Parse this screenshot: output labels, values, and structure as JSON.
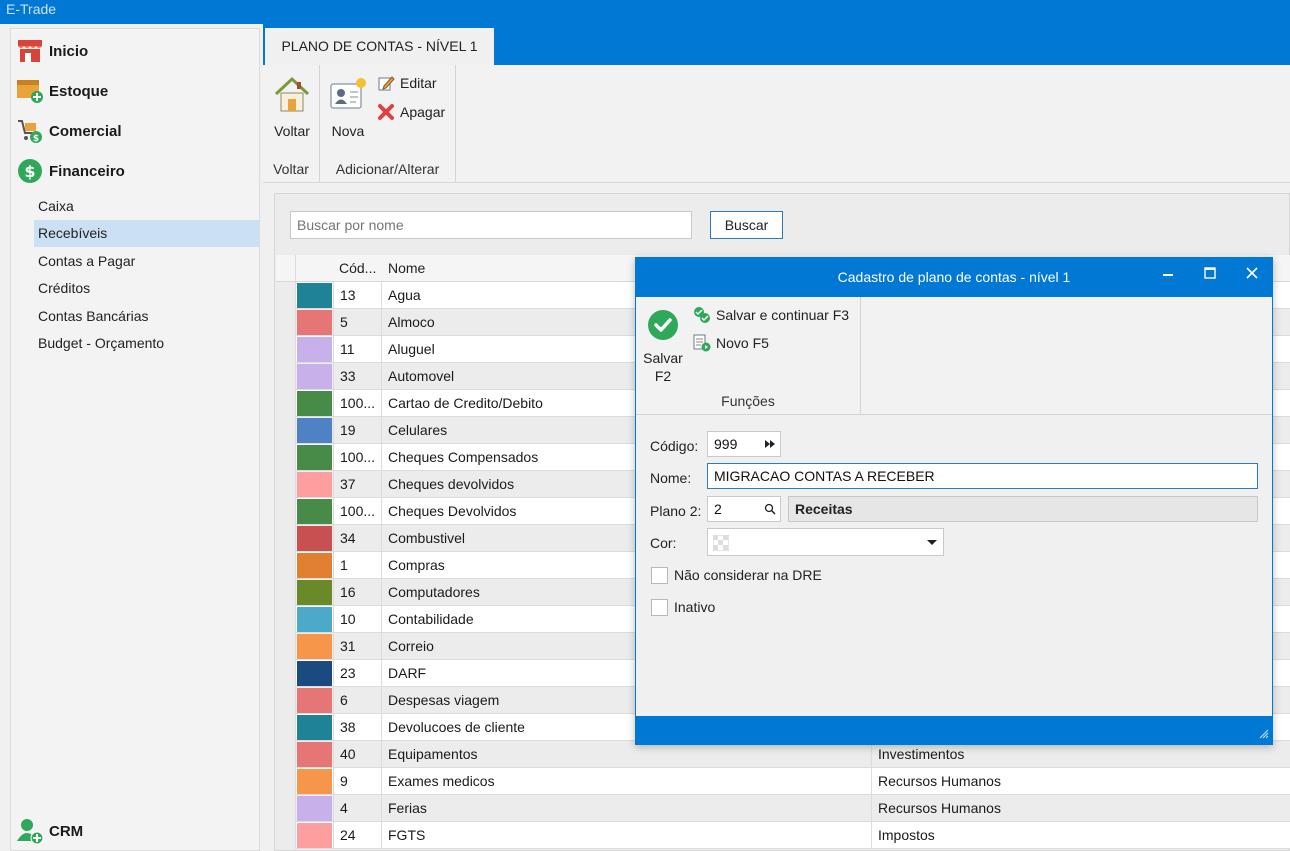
{
  "window": {
    "title": "E-Trade"
  },
  "sidebar": {
    "main": [
      {
        "label": "Inicio",
        "icon": "store-icon"
      },
      {
        "label": "Estoque",
        "icon": "box-add-icon"
      },
      {
        "label": "Comercial",
        "icon": "cart-money-icon"
      },
      {
        "label": "Financeiro",
        "icon": "dollar-circle-icon"
      }
    ],
    "sub": [
      "Caixa",
      "Recebíveis",
      "Contas a Pagar",
      "Créditos",
      "Contas Bancárias",
      "Budget - Orçamento"
    ],
    "active_sub": "Recebíveis",
    "crm": {
      "label": "CRM",
      "icon": "user-add-icon"
    }
  },
  "tab": {
    "label": "PLANO DE CONTAS - NÍVEL 1"
  },
  "ribbon": {
    "voltar_button": "Voltar",
    "voltar_group": "Voltar",
    "nova_button": "Nova",
    "editar_button": "Editar",
    "apagar_button": "Apagar",
    "adicionar_group": "Adicionar/Alterar"
  },
  "search": {
    "placeholder": "Buscar por nome",
    "button": "Buscar"
  },
  "grid": {
    "headers": {
      "codigo": "Cód...",
      "nome": "Nome",
      "plano": ""
    },
    "rows": [
      {
        "codigo": "13",
        "nome": "Agua",
        "plano": "",
        "color": "#1f8296"
      },
      {
        "codigo": "5",
        "nome": "Almoco",
        "plano": "",
        "color": "#e67575"
      },
      {
        "codigo": "11",
        "nome": "Aluguel",
        "plano": "",
        "color": "#c8b0ea"
      },
      {
        "codigo": "33",
        "nome": "Automovel",
        "plano": "",
        "color": "#c8b0ea"
      },
      {
        "codigo": "100...",
        "nome": "Cartao de Credito/Debito",
        "plano": "",
        "color": "#488a48"
      },
      {
        "codigo": "19",
        "nome": "Celulares",
        "plano": "",
        "color": "#4f82c4"
      },
      {
        "codigo": "100...",
        "nome": "Cheques Compensados",
        "plano": "",
        "color": "#488a48"
      },
      {
        "codigo": "37",
        "nome": "Cheques devolvidos",
        "plano": "",
        "color": "#ff9e9e"
      },
      {
        "codigo": "100...",
        "nome": "Cheques Devolvidos",
        "plano": "",
        "color": "#488a48"
      },
      {
        "codigo": "34",
        "nome": "Combustivel",
        "plano": "",
        "color": "#c85050"
      },
      {
        "codigo": "1",
        "nome": "Compras",
        "plano": "",
        "color": "#e08030"
      },
      {
        "codigo": "16",
        "nome": "Computadores",
        "plano": "",
        "color": "#6a8a2a"
      },
      {
        "codigo": "10",
        "nome": "Contabilidade",
        "plano": "",
        "color": "#4aaac8"
      },
      {
        "codigo": "31",
        "nome": "Correio",
        "plano": "",
        "color": "#f5964a"
      },
      {
        "codigo": "23",
        "nome": "DARF",
        "plano": "",
        "color": "#1a4a80"
      },
      {
        "codigo": "6",
        "nome": "Despesas viagem",
        "plano": "",
        "color": "#e67575"
      },
      {
        "codigo": "38",
        "nome": "Devolucoes de cliente",
        "plano": "",
        "color": "#1f8296"
      },
      {
        "codigo": "40",
        "nome": "Equipamentos",
        "plano": "Investimentos",
        "color": "#e67575"
      },
      {
        "codigo": "9",
        "nome": "Exames medicos",
        "plano": "Recursos Humanos",
        "color": "#f5964a"
      },
      {
        "codigo": "4",
        "nome": "Ferias",
        "plano": "Recursos Humanos",
        "color": "#c8b0ea"
      },
      {
        "codigo": "24",
        "nome": "FGTS",
        "plano": "Impostos",
        "color": "#ff9e9e"
      }
    ]
  },
  "dialog": {
    "title": "Cadastro de plano de contas - nível 1",
    "salvar_line1": "Salvar",
    "salvar_line2": "F2",
    "salvar_continuar": "Salvar e continuar F3",
    "novo": "Novo F5",
    "funcoes_group": "Funções",
    "codigo_label": "Código:",
    "codigo_value": "999",
    "nome_label": "Nome:",
    "nome_value": "MIGRACAO CONTAS A RECEBER",
    "plano_label": "Plano 2:",
    "plano_value": "2",
    "plano_desc": "Receitas",
    "cor_label": "Cor:",
    "dre_label": "Não considerar na DRE",
    "inativo_label": "Inativo"
  }
}
